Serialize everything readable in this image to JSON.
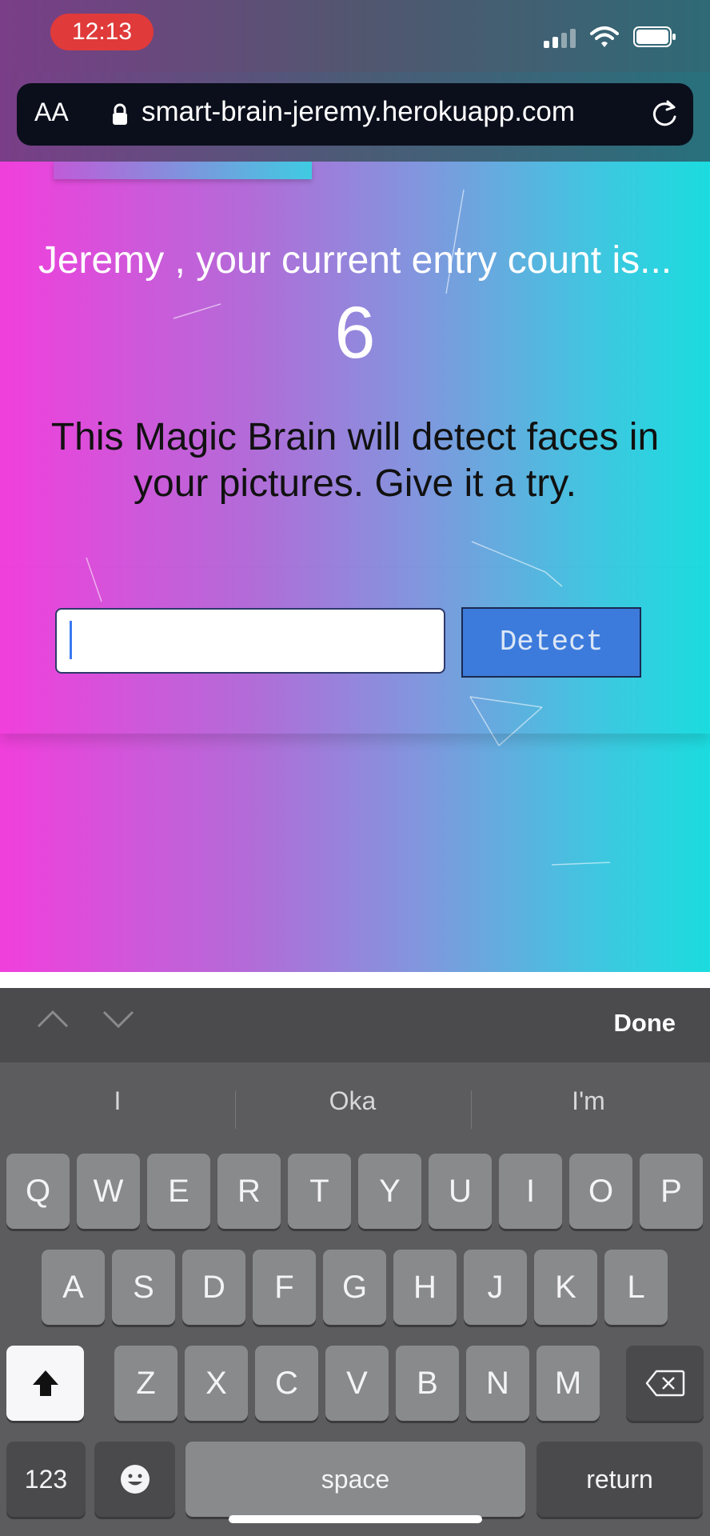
{
  "status_bar": {
    "time": "12:13"
  },
  "browser": {
    "text_size_label": "AA",
    "url": "smart-brain-jeremy.herokuapp.com"
  },
  "main": {
    "greeting": "Jeremy , your current entry count is...",
    "entry_count": "6",
    "description": "This Magic Brain will detect faces in your pictures. Give it a try.",
    "image_url_input": {
      "value": "",
      "placeholder": ""
    },
    "detect_label": "Detect"
  },
  "keyboard": {
    "done_label": "Done",
    "suggestions": [
      "I",
      "Oka",
      "I'm"
    ],
    "row1": [
      "Q",
      "W",
      "E",
      "R",
      "T",
      "Y",
      "U",
      "I",
      "O",
      "P"
    ],
    "row2": [
      "A",
      "S",
      "D",
      "F",
      "G",
      "H",
      "J",
      "K",
      "L"
    ],
    "row3": [
      "Z",
      "X",
      "C",
      "V",
      "B",
      "N",
      "M"
    ],
    "numbers_label": "123",
    "space_label": "space",
    "return_label": "return"
  },
  "colors": {
    "gradient_start": "#f13fdc",
    "gradient_end": "#1bdcdf",
    "detect_button": "#3c7bdc",
    "time_pill": "#e03a3a"
  }
}
